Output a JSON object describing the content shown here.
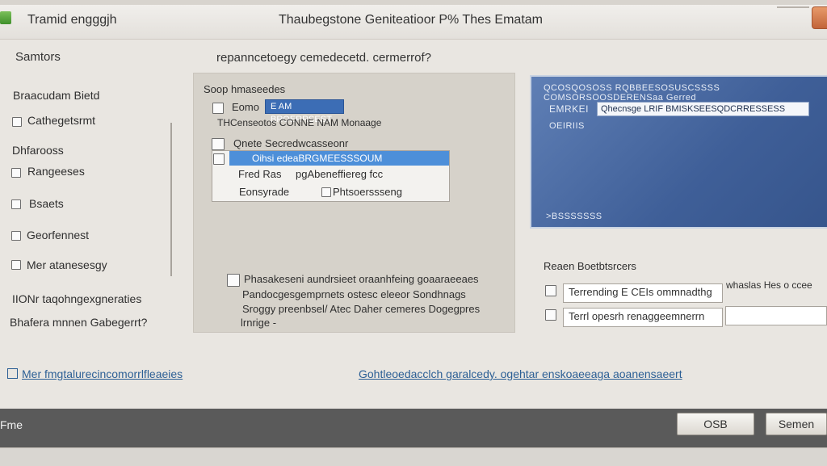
{
  "window": {
    "title": "Tramid engggjh",
    "document_title": "Thaubegstone Geniteatioor P% Thes Ematam"
  },
  "sidebar": {
    "heading": "Samtors",
    "section_label": "Braacudam Bietd",
    "items": [
      {
        "label": "Cathegetsrmt"
      },
      {
        "label": "Dhfarooss"
      },
      {
        "label": "Rangeeses"
      },
      {
        "label": "Bsaets"
      },
      {
        "label": "Georfennest"
      },
      {
        "label": "Mer atanesesgy"
      }
    ],
    "extra_line1": "IIONr taqohngexgneraties",
    "extra_line2": "Bhafera mnnen Gabegerrt?"
  },
  "main": {
    "question": "repanncetoegy cemedecetd. cermerrof?",
    "panel": {
      "heading": "Soop hmaseedes",
      "option1_label": "Eomo",
      "option1_chip": "E AM BROERRSEST",
      "subtext": "THCenseotos CONNE NAM Monaage",
      "option2_label": "Qnete Secredwcasseonr",
      "dropdown": {
        "selected": "Oihsi edeaBRGMEESSSOUM",
        "row1_left": "Fred Ras",
        "row1_right": "pgAbeneffiereg fcc",
        "row2_left": "Eonsyrade",
        "row2_right": "Phtsoerssseng"
      },
      "check_label_line1": "Phasakeseni aundrsieet oraanhfeing goaaraeeaes",
      "check_label_line2": "Pandocgesgemprnets ostesc eleeor Sondhnags",
      "check_label_line3": "Sroggy preenbsel/ Atec Daher cemeres Dogegpres",
      "check_label_line4": "lrnrige -"
    }
  },
  "bluebox": {
    "line1": "QCOSQOSOSS RQBBEESOSUSCSSSS COMSORSOOSDERENSaa Gerred",
    "label": "EMRKEI",
    "field_value": "Qhecnsge LRIF BMISKSEESQDCRRESSESS",
    "line3": "OEIRIIS",
    "bottom": ">BSSSSSSS"
  },
  "right_section": {
    "heading": "Reaen Boetbtsrcers",
    "row1_text": "Terrending E CEIs ommnadthg",
    "row1_tail": "whaslas Hes o ccee",
    "row2_text": "Terrl opesrh renaggeemnerrn"
  },
  "links": {
    "left": "Mer fmgtalurecincomorrlfleaeies",
    "right": "Gohtleoedacclch garalcedy. ogehtar enskoaeeaga aoanensaeert"
  },
  "footer": {
    "label": "Fme",
    "ok_label": "OSB",
    "cancel_label": "Semen"
  },
  "colors": {
    "accent": "#4d8fd9",
    "chip": "#3c6db5",
    "footer": "#5a5a5a",
    "panel": "#d6d2ca",
    "close": "#c2643a"
  }
}
